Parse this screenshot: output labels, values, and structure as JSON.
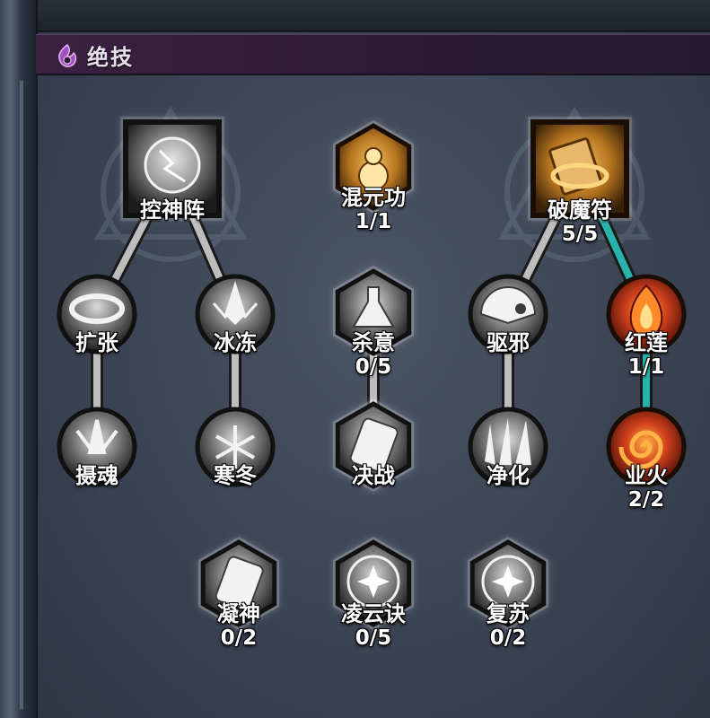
{
  "header": {
    "title": "绝技",
    "icon": "flame-swirl-icon"
  },
  "colors": {
    "link_unlocked": "#29b3ad",
    "link_locked": "#bdbdbd",
    "active_gold": "#c98a2a",
    "active_red": "#c0361e"
  },
  "skills": [
    {
      "id": "kongshenzhen",
      "name": "控神阵",
      "count": "",
      "shape": "square",
      "style": "gray",
      "icon": "lightning-orb-icon"
    },
    {
      "id": "hunyuangong",
      "name": "混元功",
      "count": "1/1",
      "shape": "hex",
      "style": "gold",
      "icon": "gourd-icon"
    },
    {
      "id": "pomofu",
      "name": "破魔符",
      "count": "5/5",
      "shape": "square",
      "style": "gold",
      "icon": "talisman-icon"
    },
    {
      "id": "kuozhang",
      "name": "扩张",
      "count": "",
      "shape": "circle",
      "style": "gray",
      "icon": "ring-icon"
    },
    {
      "id": "bingdong",
      "name": "冰冻",
      "count": "",
      "shape": "circle",
      "style": "gray",
      "icon": "ice-crystal-icon"
    },
    {
      "id": "shayi",
      "name": "杀意",
      "count": "0/5",
      "shape": "hex",
      "style": "gray",
      "icon": "potion-icon"
    },
    {
      "id": "quxie",
      "name": "驱邪",
      "count": "",
      "shape": "circle",
      "style": "gray",
      "icon": "fan-icon"
    },
    {
      "id": "honglian",
      "name": "红莲",
      "count": "1/1",
      "shape": "circle",
      "style": "red",
      "icon": "red-lotus-flame-icon"
    },
    {
      "id": "shehun",
      "name": "摄魂",
      "count": "",
      "shape": "circle",
      "style": "gray",
      "icon": "soul-burst-icon"
    },
    {
      "id": "handong",
      "name": "寒冬",
      "count": "",
      "shape": "circle",
      "style": "gray",
      "icon": "snowflake-icon"
    },
    {
      "id": "juezhan",
      "name": "决战",
      "count": "",
      "shape": "hex",
      "style": "gray",
      "icon": "scroll-icon"
    },
    {
      "id": "jinghua",
      "name": "净化",
      "count": "",
      "shape": "circle",
      "style": "gray",
      "icon": "light-rays-icon"
    },
    {
      "id": "yehuo",
      "name": "业火",
      "count": "2/2",
      "shape": "circle",
      "style": "red",
      "icon": "fire-spiral-icon"
    },
    {
      "id": "ningshen",
      "name": "凝神",
      "count": "0/2",
      "shape": "hex",
      "style": "gray",
      "icon": "meditation-scroll-icon"
    },
    {
      "id": "lingyunjue",
      "name": "凌云诀",
      "count": "0/5",
      "shape": "hex",
      "style": "gray",
      "icon": "sparkle-orb-icon"
    },
    {
      "id": "fusu",
      "name": "复苏",
      "count": "0/2",
      "shape": "hex",
      "style": "gray",
      "icon": "revive-orb-icon"
    }
  ],
  "links": [
    {
      "from": "kongshenzhen",
      "to": "kuozhang",
      "state": "locked"
    },
    {
      "from": "kongshenzhen",
      "to": "bingdong",
      "state": "locked"
    },
    {
      "from": "kuozhang",
      "to": "shehun",
      "state": "locked"
    },
    {
      "from": "bingdong",
      "to": "handong",
      "state": "locked"
    },
    {
      "from": "shayi",
      "to": "juezhan",
      "state": "locked"
    },
    {
      "from": "pomofu",
      "to": "quxie",
      "state": "locked"
    },
    {
      "from": "pomofu",
      "to": "honglian",
      "state": "unlocked"
    },
    {
      "from": "quxie",
      "to": "jinghua",
      "state": "locked"
    },
    {
      "from": "honglian",
      "to": "yehuo",
      "state": "unlocked"
    }
  ]
}
